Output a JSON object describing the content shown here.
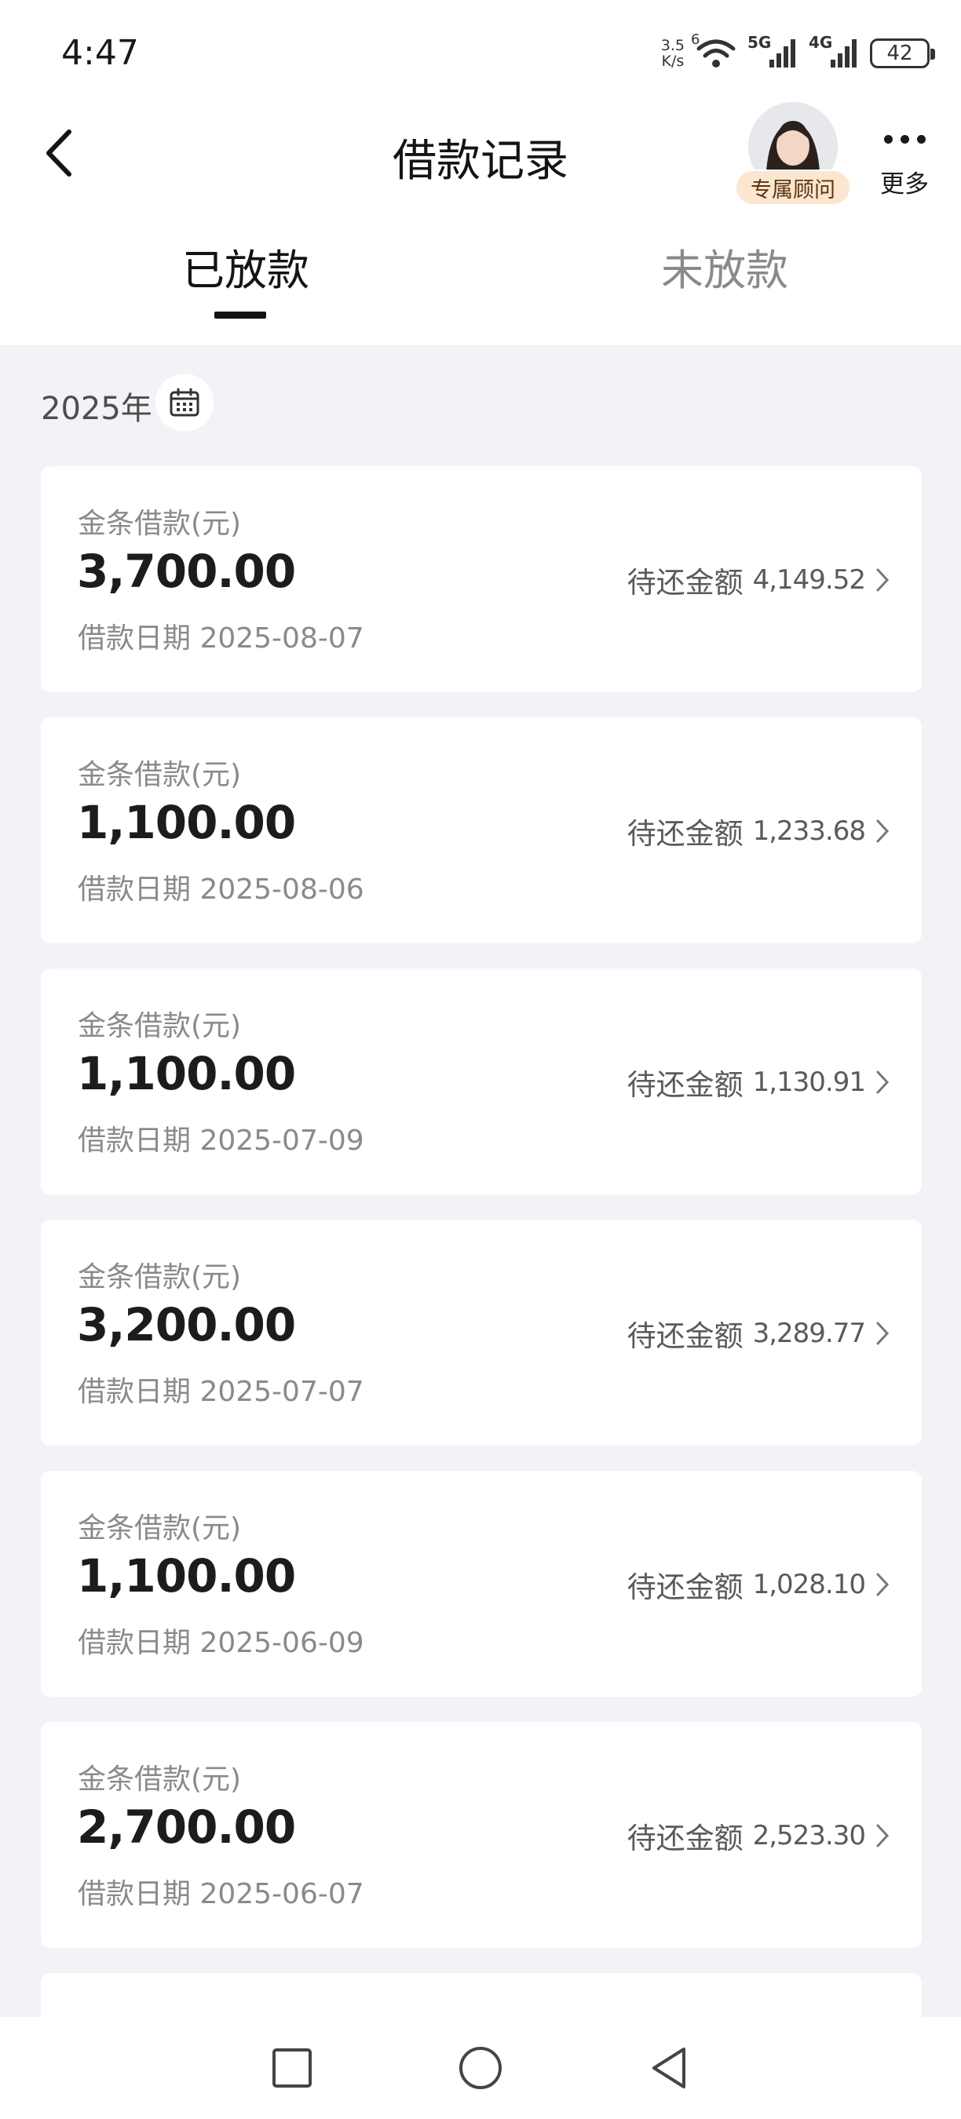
{
  "status_bar": {
    "time": "4:47",
    "net_speed_value": "3.5",
    "net_speed_unit": "K/s",
    "wifi_label": "6",
    "cell1_label": "5G",
    "cell2_label": "4G",
    "battery": "42"
  },
  "header": {
    "title": "借款记录",
    "advisor_label": "专属顾问",
    "more_label": "更多",
    "back_icon": "chevron-left-icon"
  },
  "tabs": [
    {
      "label": "已放款",
      "active": true
    },
    {
      "label": "未放款",
      "active": false
    }
  ],
  "filter": {
    "year": "2025年",
    "icon": "calendar-icon"
  },
  "loans": [
    {
      "type": "金条借款(元)",
      "amount": "3,700.00",
      "date_label": "借款日期 2025-08-07",
      "remaining_label": "待还金额",
      "remaining": "4,149.52"
    },
    {
      "type": "金条借款(元)",
      "amount": "1,100.00",
      "date_label": "借款日期 2025-08-06",
      "remaining_label": "待还金额",
      "remaining": "1,233.68"
    },
    {
      "type": "金条借款(元)",
      "amount": "1,100.00",
      "date_label": "借款日期 2025-07-09",
      "remaining_label": "待还金额",
      "remaining": "1,130.91"
    },
    {
      "type": "金条借款(元)",
      "amount": "3,200.00",
      "date_label": "借款日期 2025-07-07",
      "remaining_label": "待还金额",
      "remaining": "3,289.77"
    },
    {
      "type": "金条借款(元)",
      "amount": "1,100.00",
      "date_label": "借款日期 2025-06-09",
      "remaining_label": "待还金额",
      "remaining": "1,028.10"
    },
    {
      "type": "金条借款(元)",
      "amount": "2,700.00",
      "date_label": "借款日期 2025-06-07",
      "remaining_label": "待还金额",
      "remaining": "2,523.30"
    }
  ],
  "nav": {
    "recent": "square-icon",
    "home": "circle-icon",
    "back": "triangle-back-icon"
  },
  "colors": {
    "background": "#f2f2f7",
    "card": "#ffffff",
    "badge": "#fbe6cf",
    "text_primary": "#1c1c1c",
    "text_secondary": "#8a8a8a"
  }
}
